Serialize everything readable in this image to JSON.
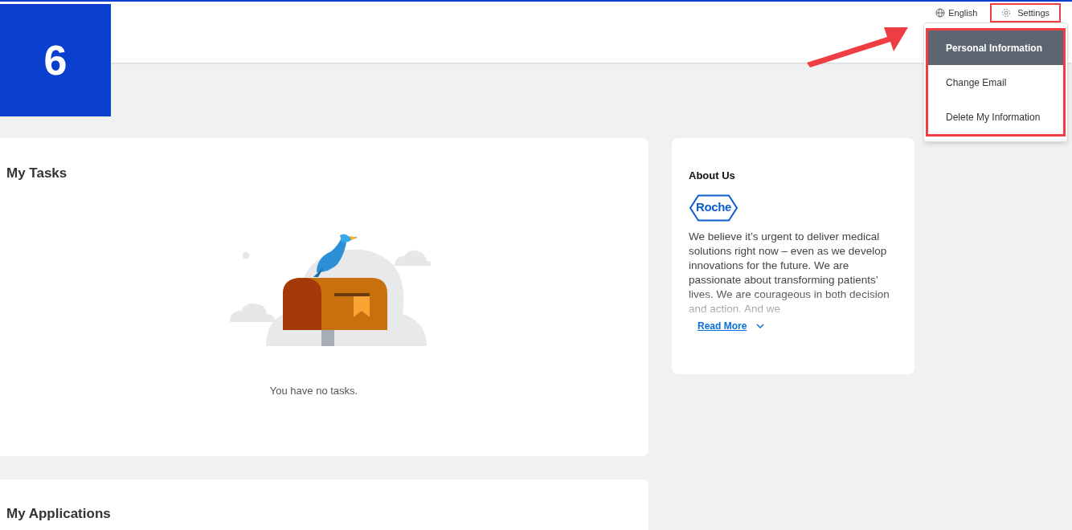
{
  "step_badge": "6",
  "header": {
    "language": "English",
    "settings": {
      "label": "Settings",
      "highlighted": true
    }
  },
  "settings_menu": {
    "highlighted": true,
    "items": [
      {
        "label": "Personal Information",
        "selected": true
      },
      {
        "label": "Change Email",
        "selected": false
      },
      {
        "label": "Delete My Information",
        "selected": false
      }
    ]
  },
  "tasks": {
    "title": "My Tasks",
    "empty_message": "You have no tasks."
  },
  "applications": {
    "title": "My Applications"
  },
  "about": {
    "title": "About Us",
    "logo_text": "Roche",
    "text": "We believe it’s urgent to deliver medical solutions right now – even as we develop innovations for the future. We are passionate about transforming patients’ lives. We are courageous in both decision and action. And we",
    "read_more": "Read More"
  }
}
